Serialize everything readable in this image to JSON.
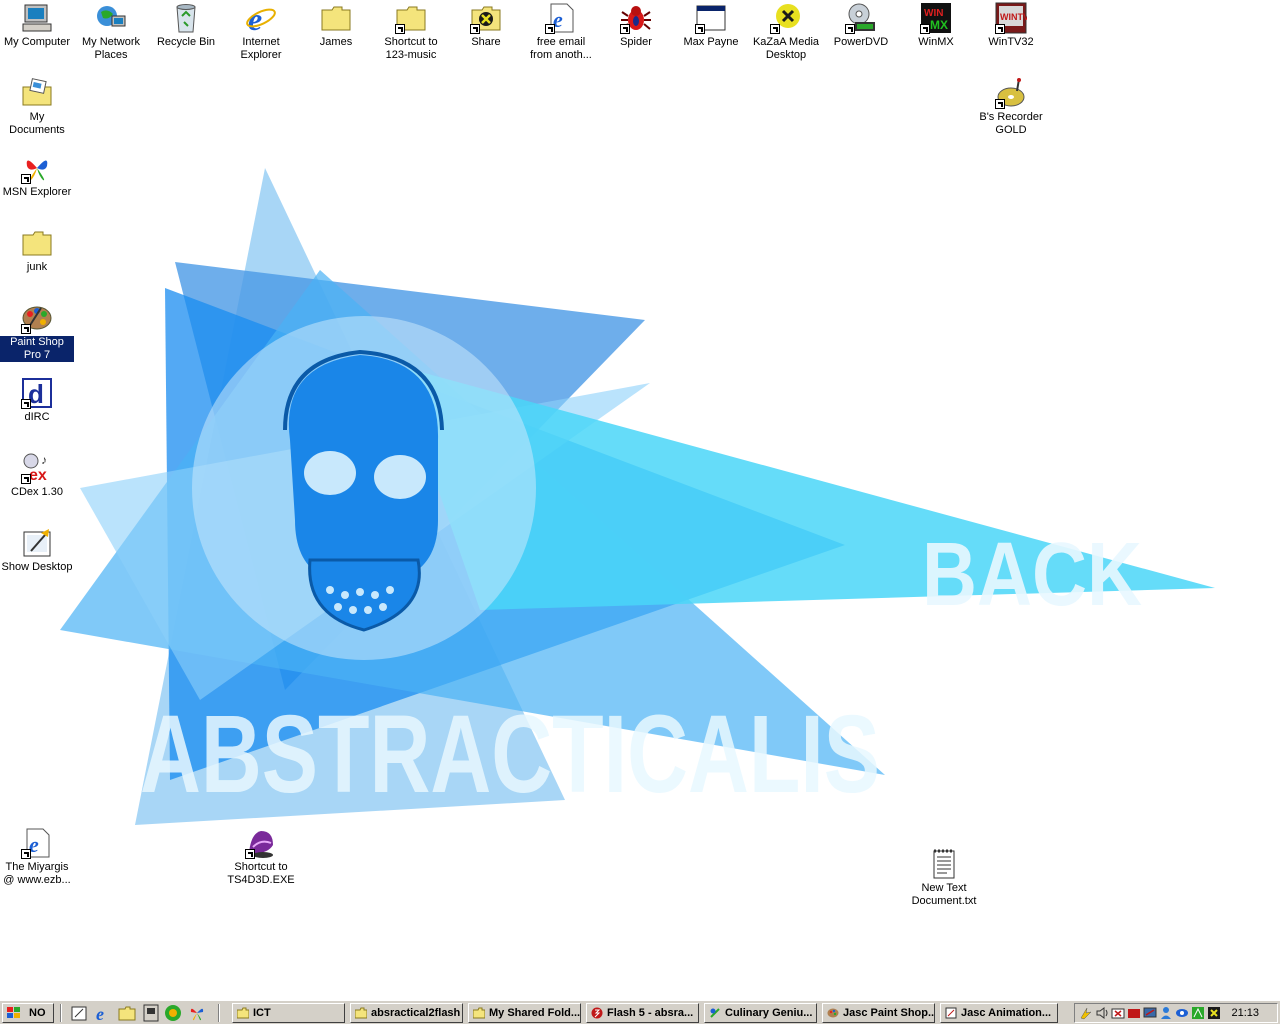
{
  "wallpaper": {
    "text_back": "BACK",
    "text_main": "ABSTRACTICALIS"
  },
  "desktop_icons": {
    "my_computer": "My Computer",
    "my_network_places": "My Network Places",
    "recycle_bin": "Recycle Bin",
    "internet_explorer": "Internet Explorer",
    "james": "James",
    "shortcut_music": "Shortcut to 123-music",
    "share": "Share",
    "free_email": "free email from anoth...",
    "spider": "Spider",
    "max_payne": "Max Payne",
    "kazaa_desktop": "KaZaA Media Desktop",
    "powerdvd": "PowerDVD",
    "winmx": "WinMX",
    "wintv32": "WinTV32",
    "bs_recorder": "B's Recorder GOLD",
    "my_documents": "My Documents",
    "msn_explorer": "MSN Explorer",
    "junk": "junk",
    "paint_shop_pro": "Paint Shop Pro 7",
    "dirc": "dIRC",
    "cdex": "CDex 1.30",
    "show_desktop": "Show Desktop",
    "miyargis": "The Miyargis @ www.ezb...",
    "shortcut_ts4d3d": "Shortcut to TS4D3D.EXE",
    "new_text_doc": "New Text Document.txt"
  },
  "taskbar": {
    "start_label": "NO",
    "tasks": [
      "ICT",
      "absractical2flash",
      "My Shared Fold...",
      "Flash 5 - absra...",
      "Culinary Geniu...",
      "Jasc Paint Shop...",
      "Jasc Animation..."
    ],
    "clock": "21:13"
  }
}
